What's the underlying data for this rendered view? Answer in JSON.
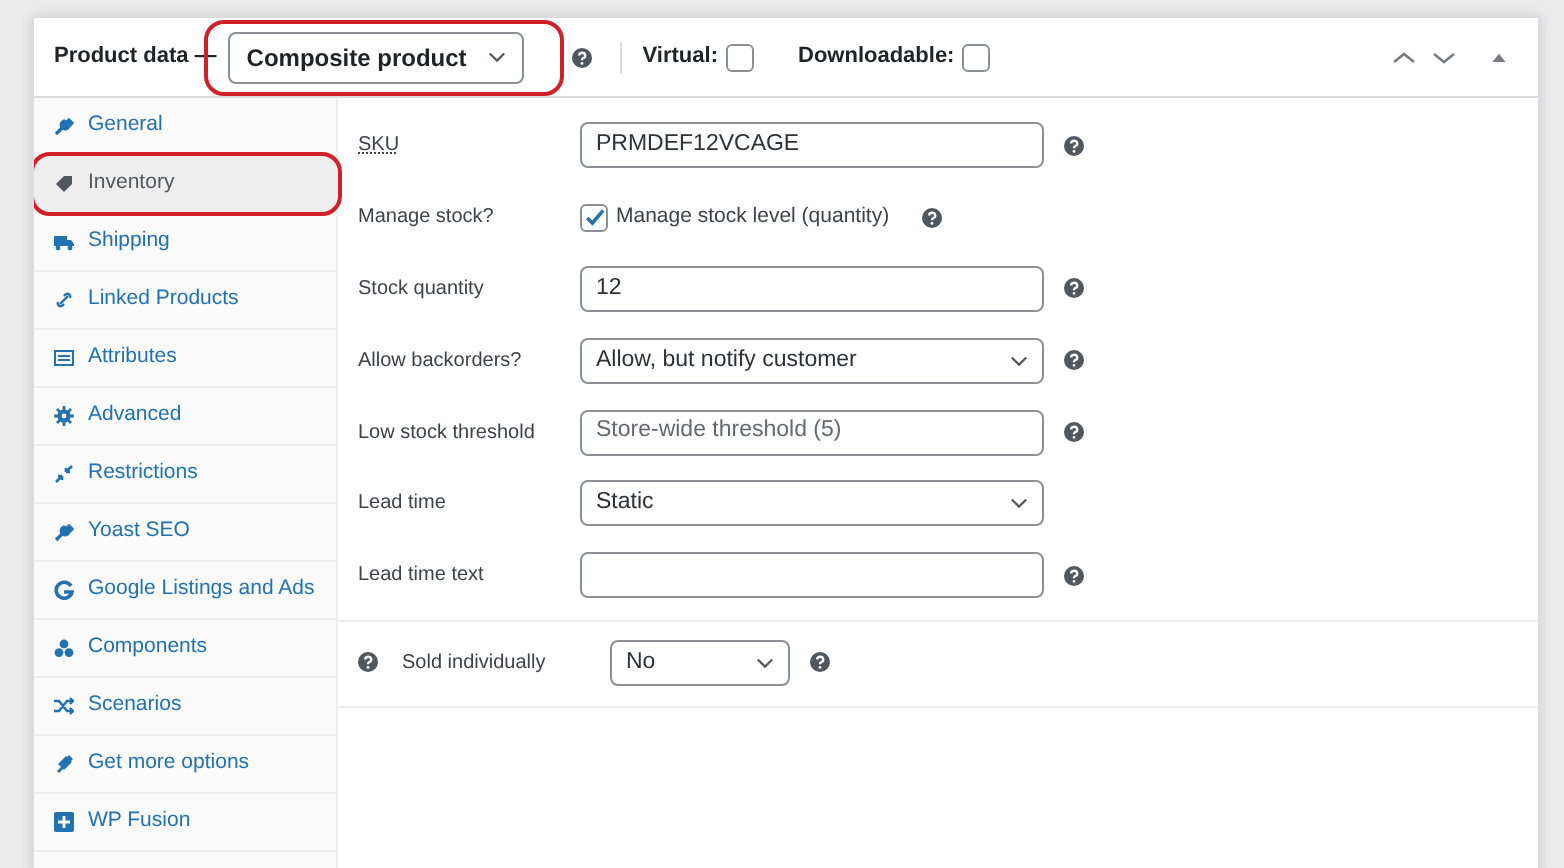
{
  "header": {
    "title": "Product data —",
    "product_type": {
      "value": "Composite product",
      "highlighted": true
    },
    "help": true,
    "options": [
      {
        "label": "Virtual:",
        "checked": false
      },
      {
        "label": "Downloadable:",
        "checked": false
      }
    ]
  },
  "sidebar": {
    "items": [
      {
        "label": "General",
        "selected": false,
        "highlighted": false
      },
      {
        "label": "Inventory",
        "selected": true,
        "highlighted": true
      },
      {
        "label": "Shipping",
        "selected": false,
        "highlighted": false
      },
      {
        "label": "Linked Products",
        "selected": false,
        "highlighted": false
      },
      {
        "label": "Attributes",
        "selected": false,
        "highlighted": false
      },
      {
        "label": "Advanced",
        "selected": false,
        "highlighted": false
      },
      {
        "label": "Restrictions",
        "selected": false,
        "highlighted": false
      },
      {
        "label": "Yoast SEO",
        "selected": false,
        "highlighted": false
      },
      {
        "label": "Google Listings and Ads",
        "selected": false,
        "highlighted": false
      },
      {
        "label": "Components",
        "selected": false,
        "highlighted": false
      },
      {
        "label": "Scenarios",
        "selected": false,
        "highlighted": false
      },
      {
        "label": "Get more options",
        "selected": false,
        "highlighted": false
      },
      {
        "label": "WP Fusion",
        "selected": false,
        "highlighted": false
      }
    ]
  },
  "fields": [
    {
      "kind": "text",
      "label": "SKU",
      "underlined": true,
      "value": "PRMDEF12VCAGE",
      "help": true
    },
    {
      "kind": "checkbox",
      "label": "Manage stock?",
      "underlined": false,
      "checked": true,
      "text": "Manage stock level (quantity)",
      "help": true
    },
    {
      "kind": "text",
      "label": "Stock quantity",
      "underlined": false,
      "value": "12",
      "help": true
    },
    {
      "kind": "select",
      "label": "Allow backorders?",
      "underlined": false,
      "value": "Allow, but notify customer",
      "help": true
    },
    {
      "kind": "text",
      "label": "Low stock threshold",
      "underlined": false,
      "placeholder": "Store-wide threshold (5)",
      "help": true
    },
    {
      "kind": "select",
      "label": "Lead time",
      "underlined": false,
      "value": "Static",
      "help": false
    },
    {
      "kind": "text",
      "label": "Lead time text",
      "underlined": false,
      "help": true
    }
  ],
  "sold_individually": {
    "label": "Sold individually",
    "value": "No"
  }
}
